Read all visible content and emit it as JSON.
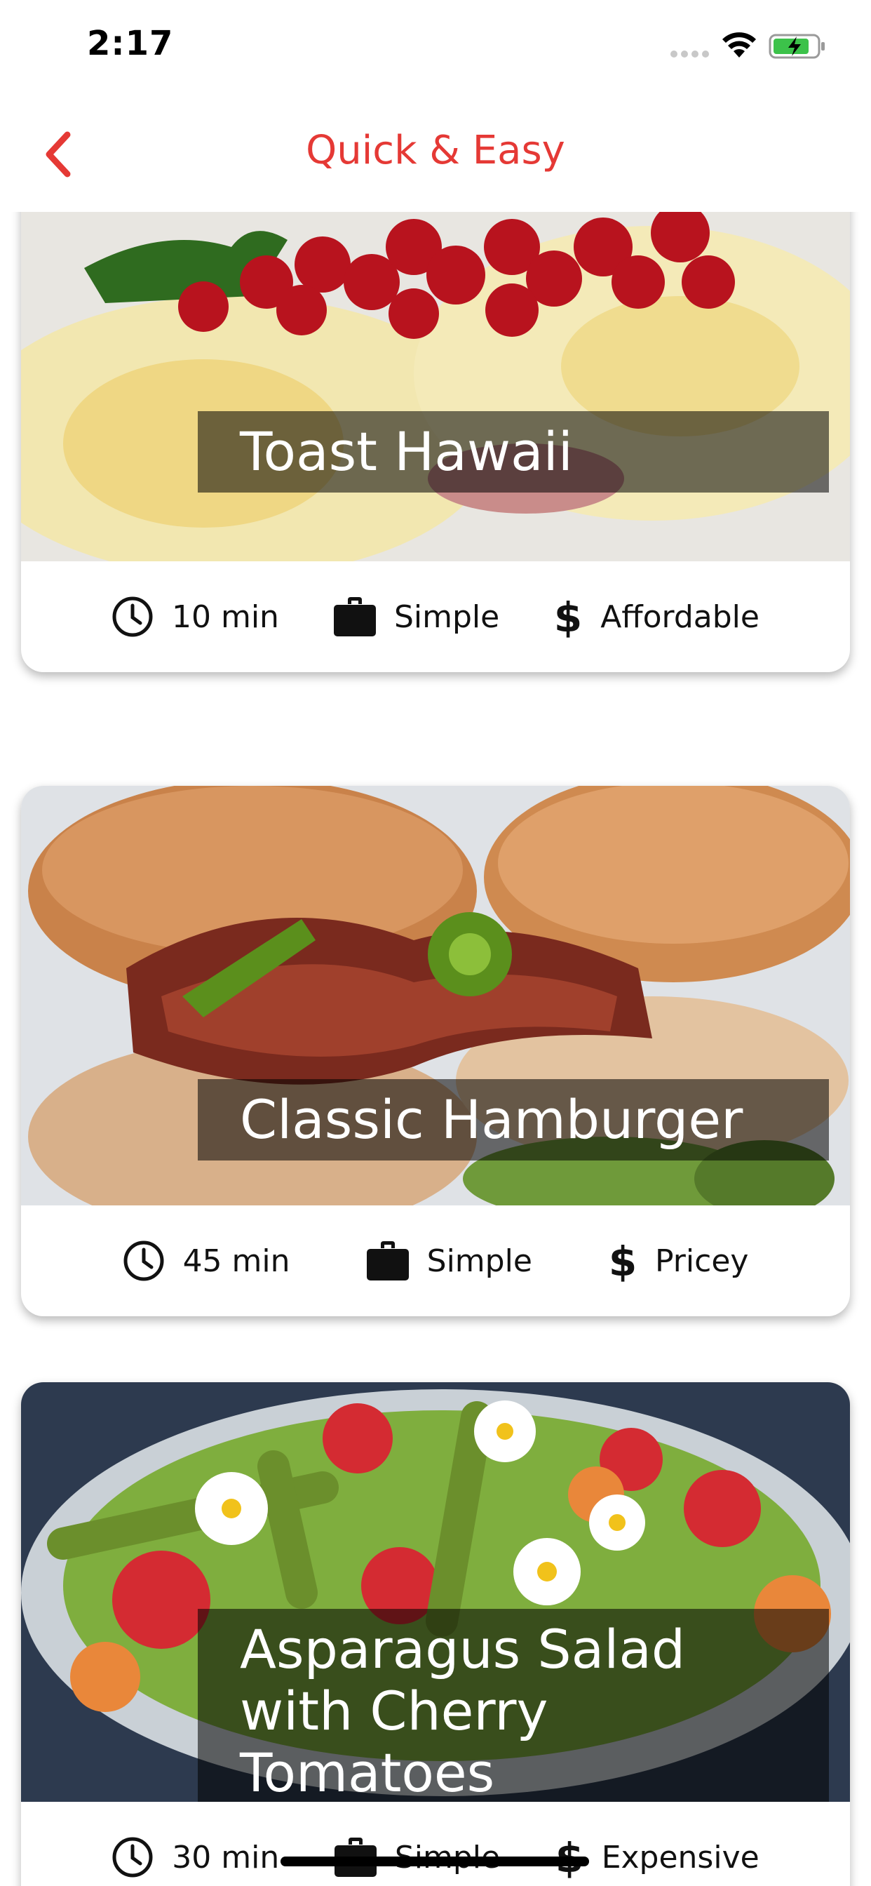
{
  "status_bar": {
    "time": "2:17"
  },
  "header": {
    "title": "Quick & Easy",
    "back_icon": "chevron-left-icon",
    "accent_color": "#e53935"
  },
  "meals": [
    {
      "title": "Toast Hawaii",
      "duration": "10 min",
      "complexity": "Simple",
      "affordability": "Affordable"
    },
    {
      "title": "Classic Hamburger",
      "duration": "45 min",
      "complexity": "Simple",
      "affordability": "Pricey"
    },
    {
      "title": "Asparagus Salad with Cherry Tomatoes",
      "duration": "30 min",
      "complexity": "Simple",
      "affordability": "Expensive"
    }
  ],
  "icons": {
    "duration": "clock-icon",
    "complexity": "briefcase-icon",
    "affordability": "dollar-icon"
  }
}
